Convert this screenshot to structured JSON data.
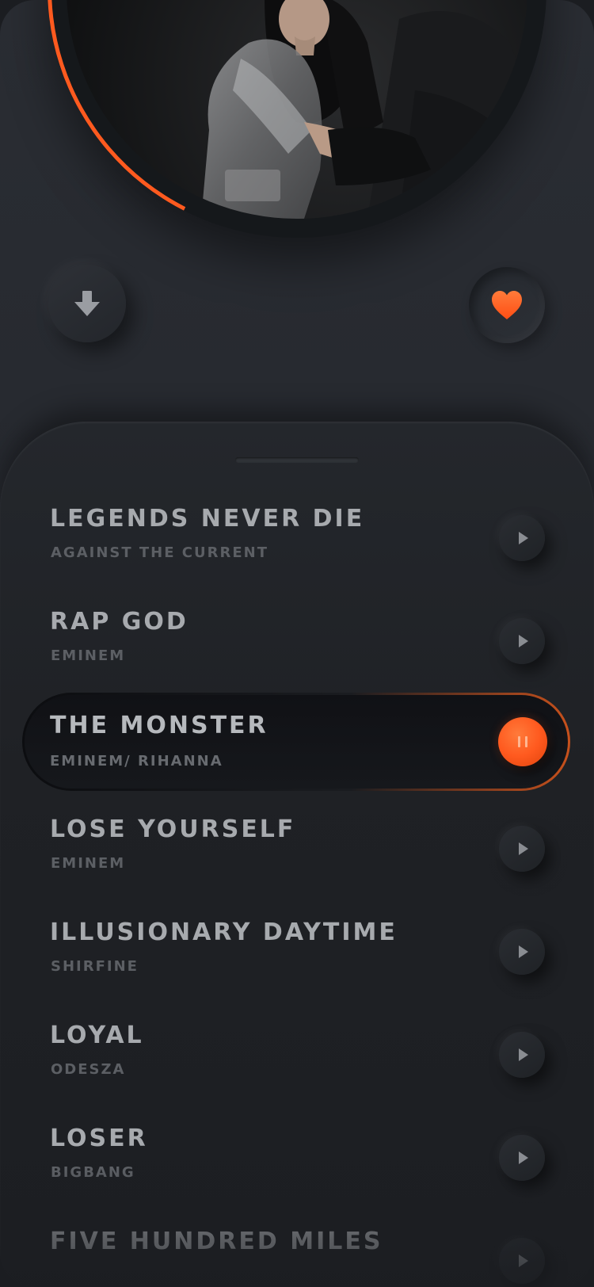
{
  "player": {
    "accent_color": "#ff5a1f",
    "album_art": {
      "description_icon": "album-photo"
    },
    "download_icon": "download-arrow-icon",
    "favorite_icon": "heart-icon",
    "favorited": true
  },
  "playlist": {
    "tracks": [
      {
        "title": "LEGENDS NEVER DIE",
        "artist": "AGAINST THE CURRENT",
        "state": "idle"
      },
      {
        "title": "RAP GOD",
        "artist": "EMINEM",
        "state": "idle"
      },
      {
        "title": "THE MONSTER",
        "artist": "EMINEM/ RIHANNA",
        "state": "playing"
      },
      {
        "title": "LOSE YOURSELF",
        "artist": "EMINEM",
        "state": "idle"
      },
      {
        "title": "ILLUSIONARY DAYTIME",
        "artist": "SHIRFINE",
        "state": "idle"
      },
      {
        "title": "LOYAL",
        "artist": "ODESZA",
        "state": "idle"
      },
      {
        "title": "LOSER",
        "artist": "BIGBANG",
        "state": "idle"
      },
      {
        "title": "FIVE HUNDRED MILES",
        "artist": "",
        "state": "idle"
      }
    ]
  }
}
